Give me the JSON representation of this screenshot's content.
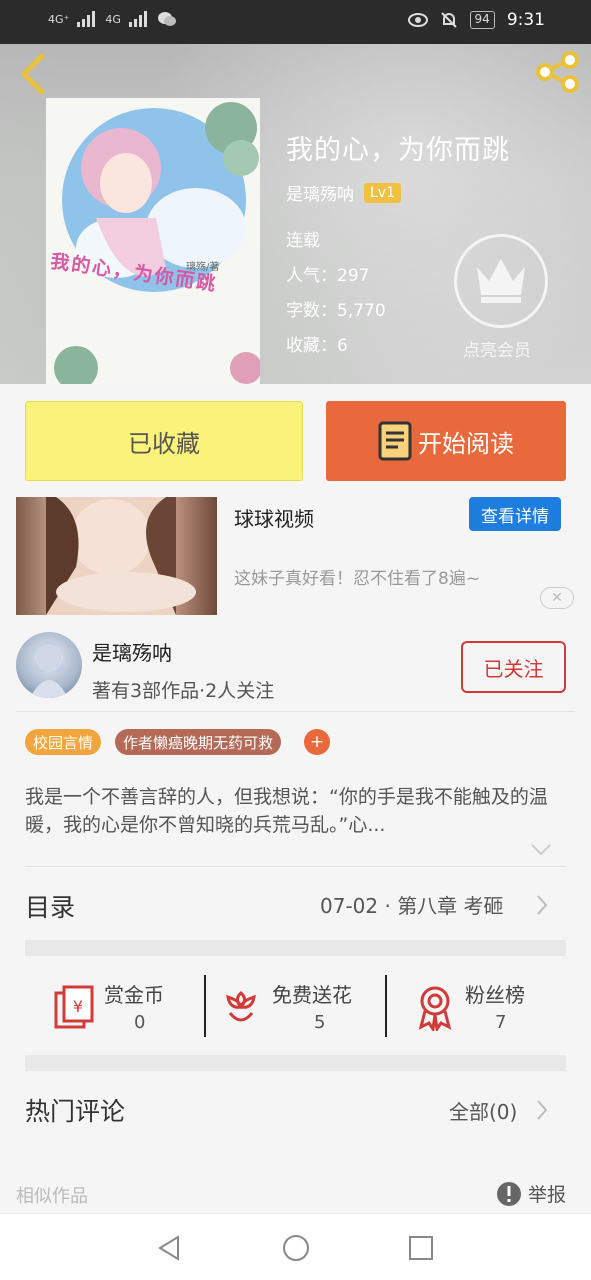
{
  "status_bar": {
    "network1": "4G⁺",
    "network2": "4G",
    "battery": "94",
    "time": "9:31"
  },
  "book": {
    "title": "我的心，为你而跳",
    "cover_title": "我的心，为你而跳",
    "cover_author": "璃殇/著",
    "author": "是璃殇呐",
    "level": "Lv1",
    "status": "连载",
    "popularity": "人气：297",
    "word_count": "字数：5,770",
    "favorites": "收藏：6",
    "vip_label": "点亮会员"
  },
  "actions": {
    "collected_label": "已收藏",
    "read_label": "开始阅读"
  },
  "ad": {
    "title": "球球视频",
    "detail_label": "查看详情",
    "description": "这妹子真好看！忍不住看了8遍~",
    "close_symbol": "✕"
  },
  "author_card": {
    "name": "是璃殇呐",
    "stats": "著有3部作品·2人关注",
    "follow_label": "已关注"
  },
  "tags": [
    "校园言情",
    "作者懒癌晚期无药可救"
  ],
  "tag_add": "+",
  "synopsis": "我是一个不善言辞的人，但我想说：“你的手是我不能触及的温暖，我的心是你不曾知晓的兵荒马乱。”心...",
  "toc": {
    "label": "目录",
    "latest": "07-02 · 第八章 考砸"
  },
  "stats": [
    {
      "label": "赏金币",
      "value": "0",
      "icon": "red-envelope-icon"
    },
    {
      "label": "免费送花",
      "value": "5",
      "icon": "flower-icon"
    },
    {
      "label": "粉丝榜",
      "value": "7",
      "icon": "medal-icon"
    }
  ],
  "comments": {
    "label": "热门评论",
    "all_label": "全部(0)"
  },
  "similar_label": "相似作品",
  "report_label": "举报",
  "colors": {
    "accent_orange": "#e8693c",
    "collected_yellow": "#fbf27a",
    "follow_red": "#d23a3a",
    "ad_blue": "#1e7ee0",
    "tag_orange": "#f0a63c",
    "tag_brown": "#b46a56"
  }
}
